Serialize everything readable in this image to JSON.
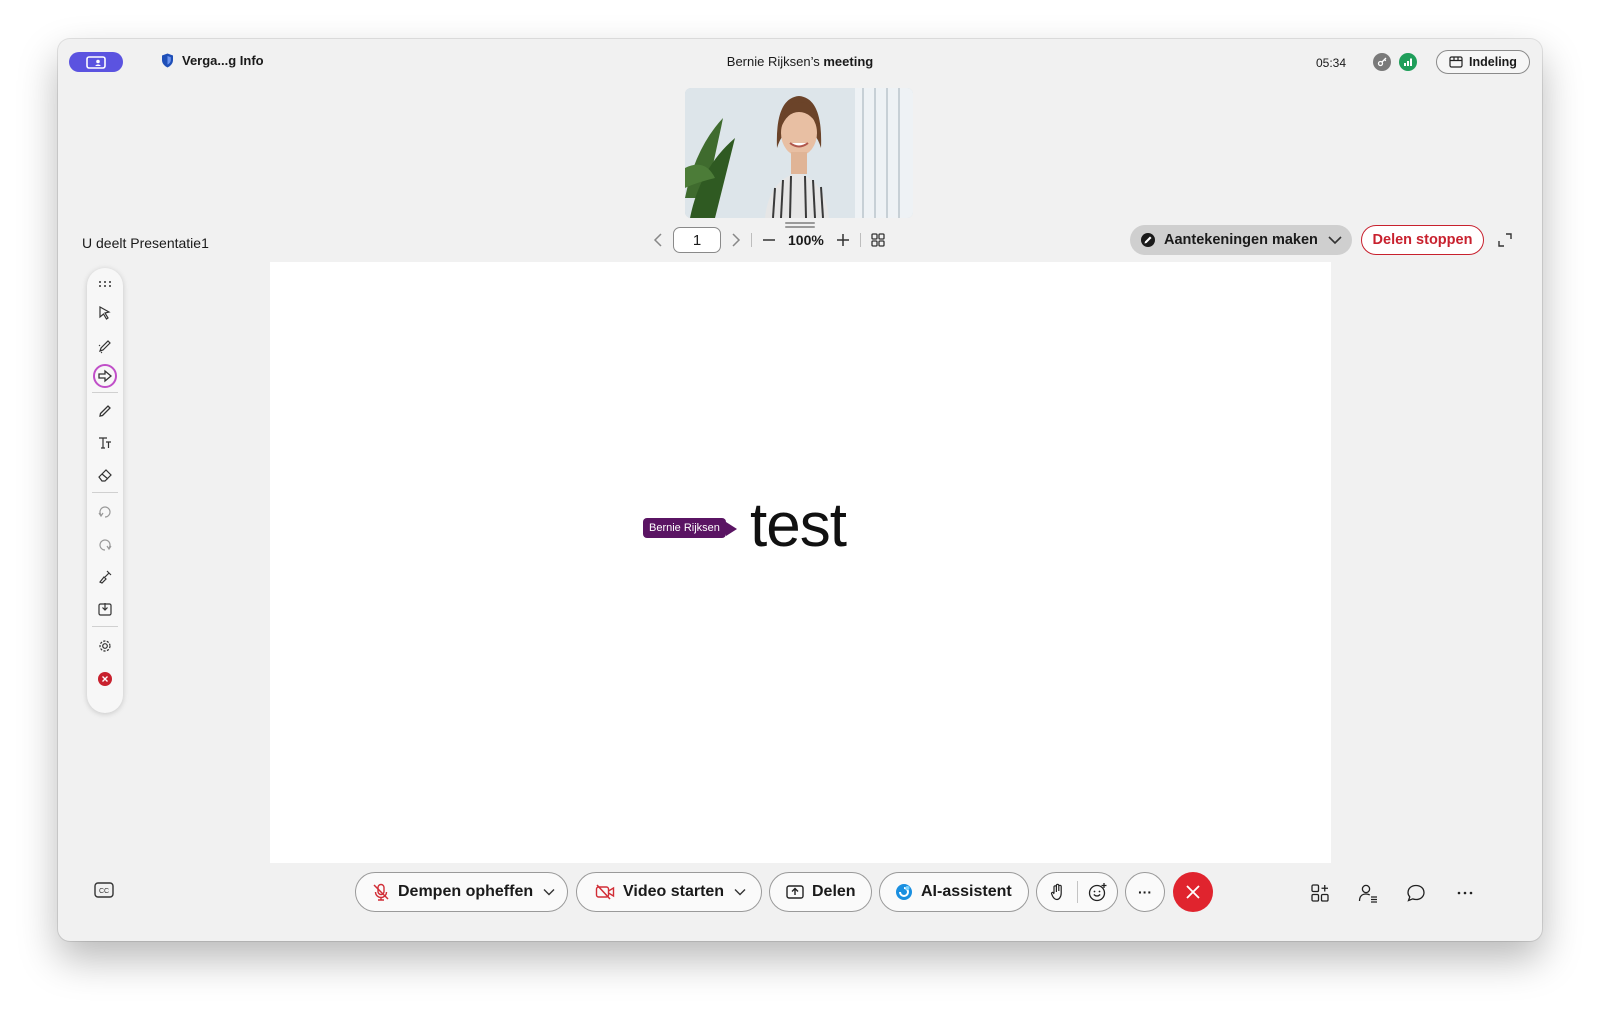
{
  "topbar": {
    "meeting_info_label": "Verga...g Info",
    "meeting_title_name": "Bernie Rijksen’s",
    "meeting_title_suffix": "meeting",
    "clock": "05:34",
    "layout_label": "Indeling"
  },
  "share": {
    "sharing_label": "U deelt Presentatie1",
    "page_number": "1",
    "zoom_level": "100%",
    "annotate_label": "Aantekeningen  maken",
    "stop_label": "Delen stoppen"
  },
  "slide": {
    "presenter_tag": "Bernie Rijksen",
    "text": "test"
  },
  "controls": {
    "mute_label": "Dempen opheffen",
    "video_label": "Video starten",
    "share_label": "Delen",
    "ai_label": "AI-assistent",
    "more_label": "···"
  },
  "colors": {
    "accent": "#5b53e0",
    "danger": "#e0242e",
    "presenter": "#5a1463",
    "status_green": "#1f9e5a"
  },
  "icons": {
    "palette": [
      "drag-handle-icon",
      "select-arrow-icon",
      "laser-pen-icon",
      "pointer-icon",
      "pen-icon",
      "text-icon",
      "eraser-icon",
      "undo-icon",
      "redo-icon",
      "clear-brush-icon",
      "save-icon",
      "settings-icon",
      "close-icon"
    ],
    "right": [
      "apps-icon",
      "participants-icon",
      "chat-icon",
      "more-options-icon"
    ]
  }
}
